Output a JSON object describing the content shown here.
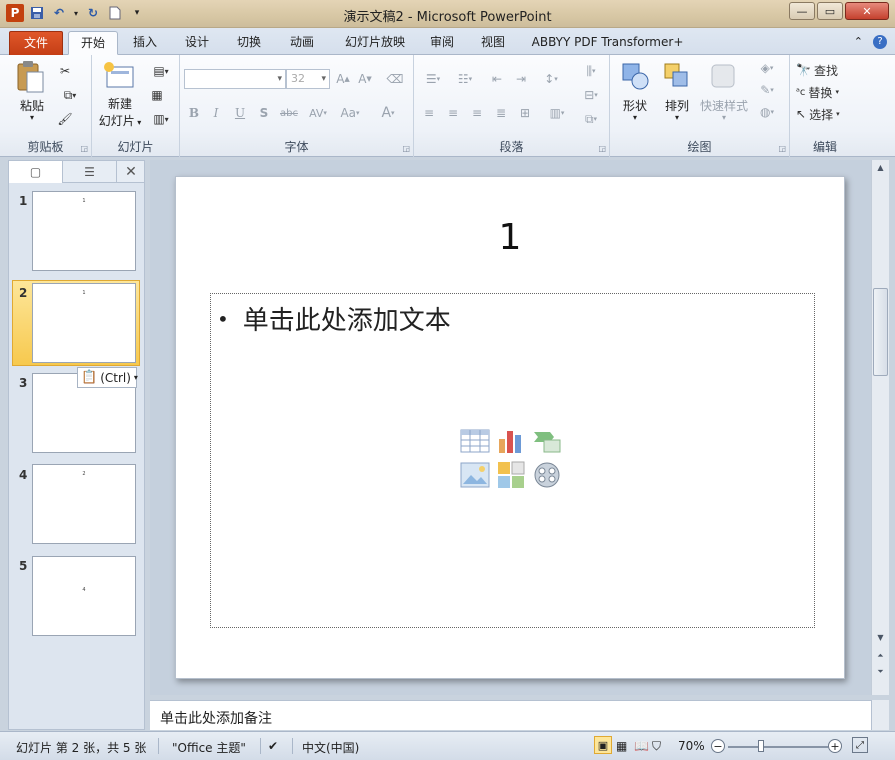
{
  "window": {
    "title": "演示文稿2 - Microsoft PowerPoint",
    "app_icon_letter": "P"
  },
  "tabs": [
    "文件",
    "开始",
    "插入",
    "设计",
    "切换",
    "动画",
    "幻灯片放映",
    "审阅",
    "视图",
    "ABBYY PDF Transformer+"
  ],
  "active_tab": "开始",
  "ribbon": {
    "clipboard": {
      "paste": "粘贴",
      "label": "剪贴板"
    },
    "slides": {
      "new_slide_line1": "新建",
      "new_slide_line2": "幻灯片",
      "label": "幻灯片"
    },
    "font": {
      "font_name": "",
      "font_size": "32",
      "label": "字体"
    },
    "paragraph": {
      "label": "段落"
    },
    "drawing": {
      "shapes": "形状",
      "arrange": "排列",
      "quick_styles": "快速样式",
      "label": "绘图"
    },
    "editing": {
      "find": "查找",
      "replace": "替换",
      "select": "选择",
      "label": "编辑"
    }
  },
  "slides_pane": {
    "thumbnails": [
      {
        "num": "1",
        "mini_text": "1"
      },
      {
        "num": "2",
        "mini_text": "1"
      },
      {
        "num": "3",
        "mini_text": ""
      },
      {
        "num": "4",
        "mini_text": "2"
      },
      {
        "num": "5",
        "mini_text": "4"
      }
    ],
    "selected_index": 2,
    "paste_options_label": "(Ctrl)"
  },
  "slide": {
    "title": "1",
    "body_placeholder": "单击此处添加文本"
  },
  "notes": {
    "placeholder": "单击此处添加备注"
  },
  "statusbar": {
    "slide_info": "幻灯片 第 2 张，共 5 张",
    "theme": "\"Office 主题\"",
    "language": "中文(中国)",
    "zoom": "70%",
    "zoom_level_percent": 70
  }
}
